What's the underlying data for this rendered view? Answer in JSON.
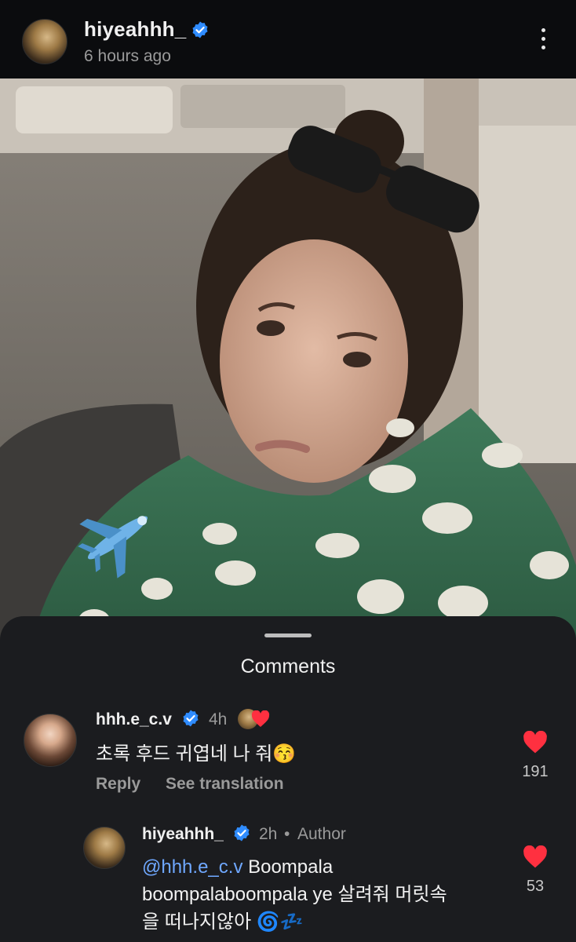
{
  "post": {
    "author": "hiyeahhh_",
    "time_ago": "6 hours ago",
    "menu_icon": "more-vertical-icon"
  },
  "photo": {
    "sticker_emoji": "✈️"
  },
  "comments_sheet": {
    "title": "Comments",
    "comments": [
      {
        "username": "hhh.e_c.v",
        "time": "4h",
        "text": "초록 후드 귀엽네 나 줘😚",
        "reply_label": "Reply",
        "translate_label": "See translation",
        "likes": "191"
      }
    ],
    "reply": {
      "username": "hiyeahhh_",
      "time": "2h",
      "separator": "•",
      "author_label": "Author",
      "mention": "@hhh.e_c.v",
      "line1_rest": " Boompala",
      "line2": "boompalaboompala ye 살려줘 머릿속",
      "line3": "을 떠나지않아 🌀💤",
      "likes": "53"
    }
  },
  "colors": {
    "background": "#0b0c0e",
    "sheet": "#1b1c1f",
    "verified": "#2f8cff",
    "heart": "#ff3040",
    "mention": "#6fa8ff"
  }
}
